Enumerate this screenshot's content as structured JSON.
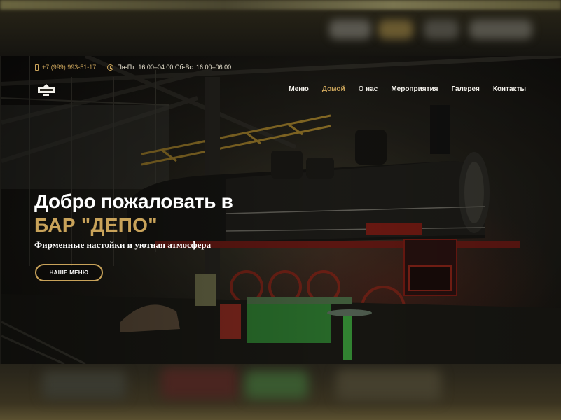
{
  "topbar": {
    "phone": "+7 (999) 993-51-17",
    "hours": "Пн-Пт: 16:00–04:00 Сб-Вс: 16:00–06:00"
  },
  "nav": {
    "items": [
      "Меню",
      "Домой",
      "О нас",
      "Мероприятия",
      "Галерея",
      "Контакты"
    ],
    "active": "Домой"
  },
  "hero": {
    "title_line1": "Добро пожаловать в",
    "title_line2": "БАР \"ДЕПО\"",
    "subtitle": "Фирменные настойки и уютная атмосфера",
    "button": "НАШЕ МЕНЮ"
  },
  "colors": {
    "accent": "#c9a35a",
    "text": "#ffffff",
    "background": "#1b1a16"
  },
  "icons": [
    "phone-icon",
    "clock-icon",
    "logo"
  ]
}
